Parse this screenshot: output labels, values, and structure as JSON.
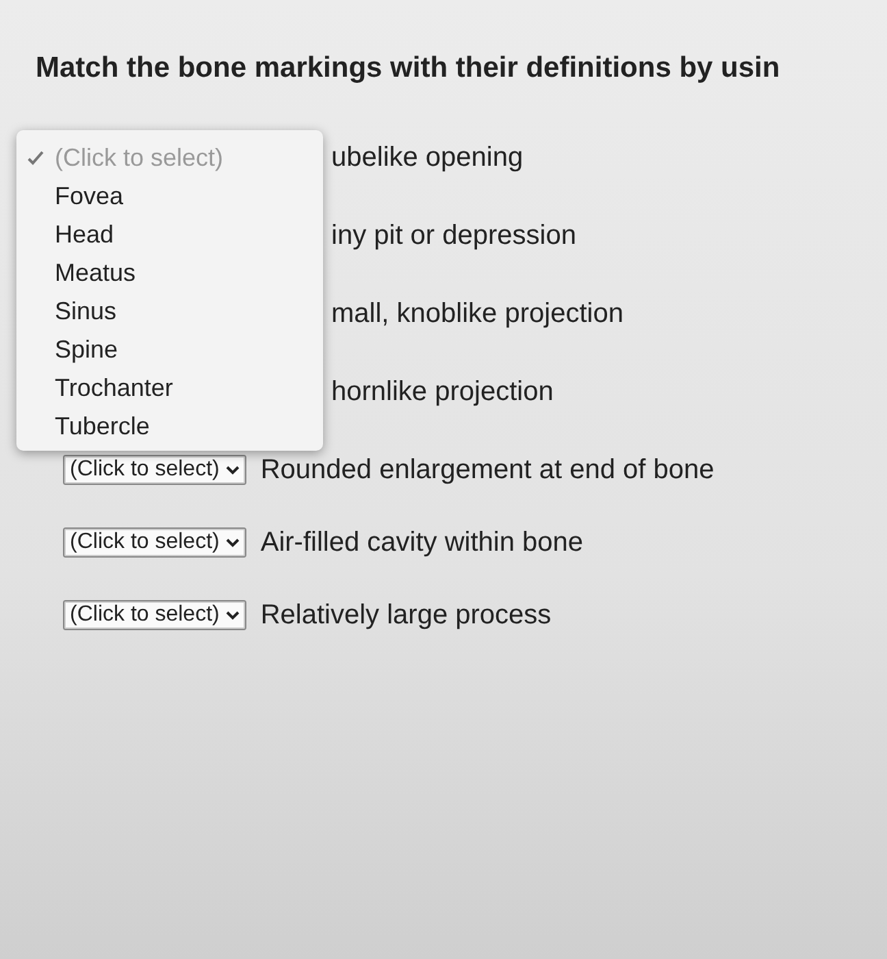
{
  "heading": "Match the bone markings with their definitions by usin",
  "dropdown_menu": {
    "options": [
      {
        "label": "(Click to select)",
        "selected": true
      },
      {
        "label": "Fovea",
        "selected": false
      },
      {
        "label": "Head",
        "selected": false
      },
      {
        "label": "Meatus",
        "selected": false
      },
      {
        "label": "Sinus",
        "selected": false
      },
      {
        "label": "Spine",
        "selected": false
      },
      {
        "label": "Trochanter",
        "selected": false
      },
      {
        "label": "Tubercle",
        "selected": false
      }
    ]
  },
  "rows": [
    {
      "definition": "ubelike opening"
    },
    {
      "definition": "iny pit or depression"
    },
    {
      "definition": "mall, knoblike projection"
    },
    {
      "definition": "hornlike projection"
    },
    {
      "select": "(Click to select)",
      "definition": "Rounded enlargement at end of bone"
    },
    {
      "select": "(Click to select)",
      "definition": "Air-filled cavity within bone"
    },
    {
      "select": "(Click to select)",
      "definition": "Relatively large process"
    }
  ]
}
